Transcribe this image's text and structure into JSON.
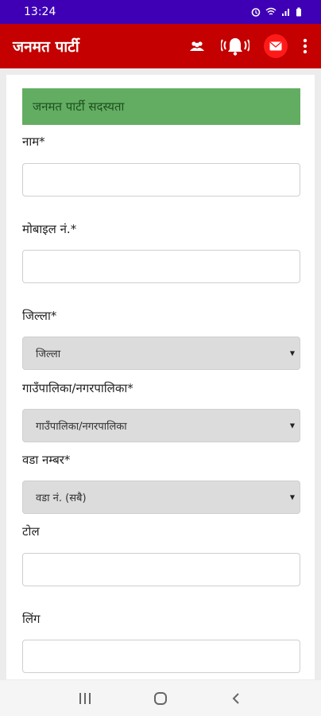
{
  "status_bar": {
    "time": "13:24",
    "signal_text": "⏰ ᯤ ıl ▮"
  },
  "app_bar": {
    "title": "जनमत पार्टी",
    "icons": [
      "group-icon",
      "notification-bell-icon",
      "mail-icon",
      "more-vert-icon"
    ]
  },
  "form": {
    "banner": "जनमत पार्टी सदस्यता",
    "name_label": "नाम*",
    "mobile_label": "मोबाइल नं.*",
    "district_label": "जिल्ला*",
    "district_value": "जिल्ला",
    "municipality_label": "गाउँपालिका/नगरपालिका*",
    "municipality_value": "गाउँपालिका/नगरपालिका",
    "ward_label": "वडा नम्बर*",
    "ward_value": "वडा नं. (सबै)",
    "tol_label": "टोल",
    "gender_label": "लिंग"
  },
  "nav_bar": {
    "icons": [
      "recents-icon",
      "home-icon",
      "back-icon"
    ]
  }
}
